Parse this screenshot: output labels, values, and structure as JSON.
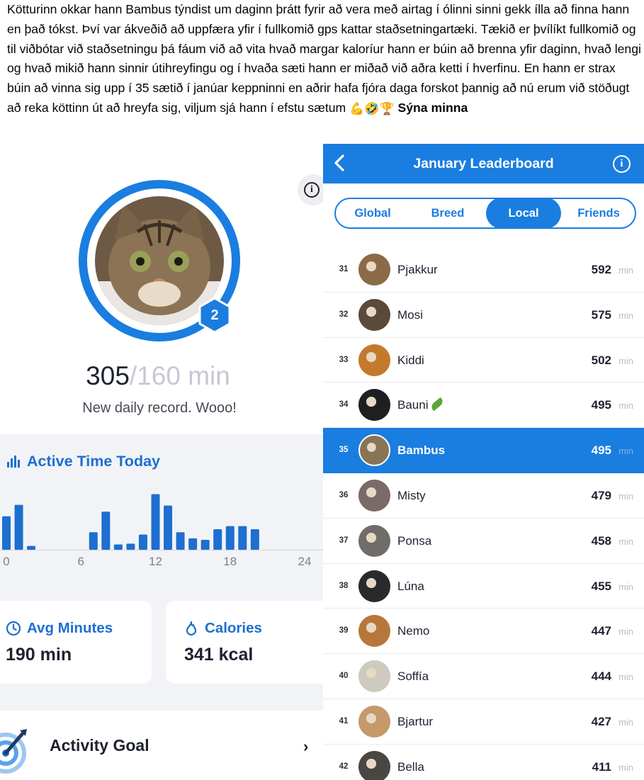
{
  "post": {
    "text": "Kötturinn okkar hann Bambus týndist um daginn þrátt fyrir að vera með airtag í ólinni sinni gekk ílla að finna hann en það tókst. Því var ákveðið að uppfæra yfir í fullkomið gps kattar staðsetningartæki. Tækið er þvílíkt fullkomið og til viðbótar við staðsetningu þá fáum við að vita hvað margar kaloríur hann er búin að brenna yfir daginn, hvað lengi og hvað mikið hann sinnir útihreyfingu og í hvaða sæti hann er miðað við aðra ketti í hverfinu. En hann er strax búin að vinna sig upp í 35 sætið í janúar keppninni en aðrir hafa fjóra daga forskot þannig að nú erum við stöðugt að reka köttinn út að hreyfa sig, viljum sjá hann í efstu sætum",
    "emojis": [
      "💪",
      "🤣",
      "🏆"
    ],
    "see_less": "Sýna minna"
  },
  "profile": {
    "rank_badge": "2",
    "minutes_today": "305",
    "minutes_goal": "/160 min",
    "record_message": "New daily record. Wooo!"
  },
  "activity": {
    "title": "Active Time Today",
    "x_ticks": [
      "0",
      "6",
      "12",
      "18",
      "24"
    ]
  },
  "chart_data": {
    "type": "bar",
    "title": "Active Time Today",
    "x": [
      0,
      1,
      2,
      7,
      8,
      9,
      10,
      11,
      12,
      13,
      14,
      15,
      16,
      17,
      18,
      19,
      20
    ],
    "values": [
      44,
      59,
      5,
      23,
      50,
      7,
      8,
      20,
      73,
      58,
      23,
      15,
      13,
      27,
      31,
      31,
      27
    ],
    "xlim": [
      0,
      24
    ],
    "ylim": [
      0,
      80
    ],
    "xlabel": "",
    "ylabel": "",
    "grid": false,
    "color": "#1d6fd0"
  },
  "stats": {
    "avg_label": "Avg Minutes",
    "avg_value": "190 min",
    "cal_label": "Calories",
    "cal_value": "341 kcal"
  },
  "goal": {
    "label": "Activity Goal"
  },
  "leaderboard": {
    "title": "January Leaderboard",
    "info_icon": "i",
    "tabs": [
      {
        "label": "Global"
      },
      {
        "label": "Breed"
      },
      {
        "label": "Local"
      },
      {
        "label": "Friends"
      }
    ],
    "active_tab": "Local",
    "unit": "min",
    "rows": [
      {
        "rank": "31",
        "name": "Pjakkur",
        "minutes": "592",
        "avatar_color": "#8b6a48"
      },
      {
        "rank": "32",
        "name": "Mosi",
        "minutes": "575",
        "avatar_color": "#5a4a3a"
      },
      {
        "rank": "33",
        "name": "Kiddi",
        "minutes": "502",
        "avatar_color": "#c47a2c"
      },
      {
        "rank": "34",
        "name": "Bauni",
        "minutes": "495",
        "avatar_color": "#1f1f22",
        "emoji": "cucumber"
      },
      {
        "rank": "35",
        "name": "Bambus",
        "minutes": "495",
        "avatar_color": "#8a7458",
        "highlight": true
      },
      {
        "rank": "36",
        "name": "Misty",
        "minutes": "479",
        "avatar_color": "#7a6a68"
      },
      {
        "rank": "37",
        "name": "Ponsa",
        "minutes": "458",
        "avatar_color": "#6f6c6a"
      },
      {
        "rank": "38",
        "name": "Lúna",
        "minutes": "455",
        "avatar_color": "#2a2a2c"
      },
      {
        "rank": "39",
        "name": "Nemo",
        "minutes": "447",
        "avatar_color": "#b7773a"
      },
      {
        "rank": "40",
        "name": "Soffía",
        "minutes": "444",
        "avatar_color": "#cfcac0"
      },
      {
        "rank": "41",
        "name": "Bjartur",
        "minutes": "427",
        "avatar_color": "#c49a6a"
      },
      {
        "rank": "42",
        "name": "Bella",
        "minutes": "411",
        "avatar_color": "#4a4644"
      }
    ]
  },
  "colors": {
    "accent": "#1a7de0",
    "accent_dark": "#1d6fd0",
    "highlight_row": "#1a7de0"
  }
}
